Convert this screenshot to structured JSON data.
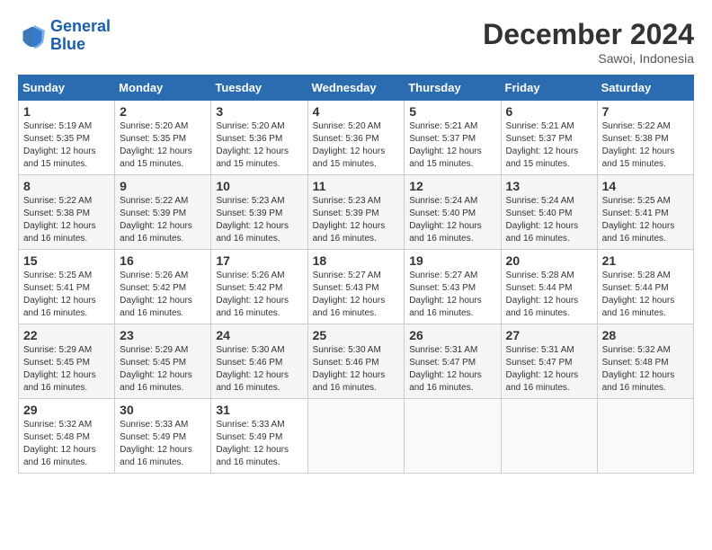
{
  "logo": {
    "line1": "General",
    "line2": "Blue"
  },
  "title": "December 2024",
  "location": "Sawoi, Indonesia",
  "headers": [
    "Sunday",
    "Monday",
    "Tuesday",
    "Wednesday",
    "Thursday",
    "Friday",
    "Saturday"
  ],
  "weeks": [
    [
      {
        "day": "1",
        "sunrise": "5:19 AM",
        "sunset": "5:35 PM",
        "daylight": "12 hours and 15 minutes."
      },
      {
        "day": "2",
        "sunrise": "5:20 AM",
        "sunset": "5:35 PM",
        "daylight": "12 hours and 15 minutes."
      },
      {
        "day": "3",
        "sunrise": "5:20 AM",
        "sunset": "5:36 PM",
        "daylight": "12 hours and 15 minutes."
      },
      {
        "day": "4",
        "sunrise": "5:20 AM",
        "sunset": "5:36 PM",
        "daylight": "12 hours and 15 minutes."
      },
      {
        "day": "5",
        "sunrise": "5:21 AM",
        "sunset": "5:37 PM",
        "daylight": "12 hours and 15 minutes."
      },
      {
        "day": "6",
        "sunrise": "5:21 AM",
        "sunset": "5:37 PM",
        "daylight": "12 hours and 15 minutes."
      },
      {
        "day": "7",
        "sunrise": "5:22 AM",
        "sunset": "5:38 PM",
        "daylight": "12 hours and 15 minutes."
      }
    ],
    [
      {
        "day": "8",
        "sunrise": "5:22 AM",
        "sunset": "5:38 PM",
        "daylight": "12 hours and 16 minutes."
      },
      {
        "day": "9",
        "sunrise": "5:22 AM",
        "sunset": "5:39 PM",
        "daylight": "12 hours and 16 minutes."
      },
      {
        "day": "10",
        "sunrise": "5:23 AM",
        "sunset": "5:39 PM",
        "daylight": "12 hours and 16 minutes."
      },
      {
        "day": "11",
        "sunrise": "5:23 AM",
        "sunset": "5:39 PM",
        "daylight": "12 hours and 16 minutes."
      },
      {
        "day": "12",
        "sunrise": "5:24 AM",
        "sunset": "5:40 PM",
        "daylight": "12 hours and 16 minutes."
      },
      {
        "day": "13",
        "sunrise": "5:24 AM",
        "sunset": "5:40 PM",
        "daylight": "12 hours and 16 minutes."
      },
      {
        "day": "14",
        "sunrise": "5:25 AM",
        "sunset": "5:41 PM",
        "daylight": "12 hours and 16 minutes."
      }
    ],
    [
      {
        "day": "15",
        "sunrise": "5:25 AM",
        "sunset": "5:41 PM",
        "daylight": "12 hours and 16 minutes."
      },
      {
        "day": "16",
        "sunrise": "5:26 AM",
        "sunset": "5:42 PM",
        "daylight": "12 hours and 16 minutes."
      },
      {
        "day": "17",
        "sunrise": "5:26 AM",
        "sunset": "5:42 PM",
        "daylight": "12 hours and 16 minutes."
      },
      {
        "day": "18",
        "sunrise": "5:27 AM",
        "sunset": "5:43 PM",
        "daylight": "12 hours and 16 minutes."
      },
      {
        "day": "19",
        "sunrise": "5:27 AM",
        "sunset": "5:43 PM",
        "daylight": "12 hours and 16 minutes."
      },
      {
        "day": "20",
        "sunrise": "5:28 AM",
        "sunset": "5:44 PM",
        "daylight": "12 hours and 16 minutes."
      },
      {
        "day": "21",
        "sunrise": "5:28 AM",
        "sunset": "5:44 PM",
        "daylight": "12 hours and 16 minutes."
      }
    ],
    [
      {
        "day": "22",
        "sunrise": "5:29 AM",
        "sunset": "5:45 PM",
        "daylight": "12 hours and 16 minutes."
      },
      {
        "day": "23",
        "sunrise": "5:29 AM",
        "sunset": "5:45 PM",
        "daylight": "12 hours and 16 minutes."
      },
      {
        "day": "24",
        "sunrise": "5:30 AM",
        "sunset": "5:46 PM",
        "daylight": "12 hours and 16 minutes."
      },
      {
        "day": "25",
        "sunrise": "5:30 AM",
        "sunset": "5:46 PM",
        "daylight": "12 hours and 16 minutes."
      },
      {
        "day": "26",
        "sunrise": "5:31 AM",
        "sunset": "5:47 PM",
        "daylight": "12 hours and 16 minutes."
      },
      {
        "day": "27",
        "sunrise": "5:31 AM",
        "sunset": "5:47 PM",
        "daylight": "12 hours and 16 minutes."
      },
      {
        "day": "28",
        "sunrise": "5:32 AM",
        "sunset": "5:48 PM",
        "daylight": "12 hours and 16 minutes."
      }
    ],
    [
      {
        "day": "29",
        "sunrise": "5:32 AM",
        "sunset": "5:48 PM",
        "daylight": "12 hours and 16 minutes."
      },
      {
        "day": "30",
        "sunrise": "5:33 AM",
        "sunset": "5:49 PM",
        "daylight": "12 hours and 16 minutes."
      },
      {
        "day": "31",
        "sunrise": "5:33 AM",
        "sunset": "5:49 PM",
        "daylight": "12 hours and 16 minutes."
      },
      null,
      null,
      null,
      null
    ]
  ]
}
